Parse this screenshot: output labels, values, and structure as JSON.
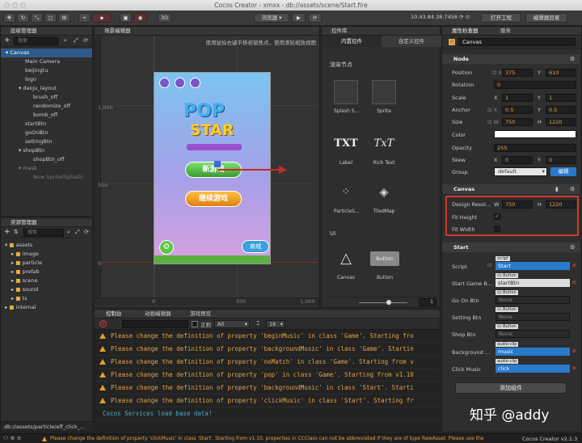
{
  "window": {
    "title": "Cocos Creator - xmxx - db://assets/scene/Start.fire"
  },
  "toolbar": {
    "btn_3d": "3D",
    "browser": "浏览器 ▾",
    "ip": "10.43.84.38:7456 ⟳ ⊙",
    "open_project": "打开工程",
    "open_editor": "编辑器目录"
  },
  "hierarchy": {
    "title": "层级管理器",
    "search": "搜索",
    "items": [
      "Canvas",
      "Main Camera",
      "beijingtu",
      "logo",
      "daoju_layout",
      "brush_off",
      "randomize_off",
      "bomb_off",
      "startBtn",
      "goOnBtn",
      "settingBtn",
      "shopBtn",
      "shopBtn_off",
      "mask",
      "New Sprite(Splash)"
    ]
  },
  "assets": {
    "title": "资源管理器",
    "search": "搜索",
    "items": [
      "assets",
      "image",
      "particle",
      "prefab",
      "scene",
      "sound",
      "ts",
      "internal"
    ],
    "path": "db://assets/particle/eff_click_..."
  },
  "scene": {
    "tab": "场景编辑器",
    "hint": "使用鼠标右键平移视窗焦点，使用滚轮缩放视图",
    "y_labels": [
      "1,000",
      "500",
      "0"
    ],
    "x_labels": [
      "0",
      "500",
      "1,000"
    ],
    "start_btn": "新游戏",
    "continue_btn": "继续游戏",
    "shop": "商城",
    "pop": "POP",
    "star": "STAR"
  },
  "bottom_tabs": [
    "控制台",
    "动画编辑器",
    "游戏预览"
  ],
  "console": {
    "level": "All",
    "font_size": "16",
    "regex": "正则",
    "logs": [
      "Please change the definition of property 'beginMusic' in class 'Game'. Starting fro",
      "Please change the definition of property 'backgroundMusic' in class 'Game'. Startin",
      "Please change the definition of property 'noMatch' in class 'Game'. Starting from v",
      "Please change the definition of property 'pop' in class 'Game'. Starting from v1.10",
      "Please change the definition of property 'backgroundMusic' in class 'Start'. Starti",
      "Please change the definition of property 'clickMusic' in class 'Start'. Starting fr"
    ],
    "service": "Cocos Services load base data!"
  },
  "library": {
    "title": "控件库",
    "tab_builtin": "内置控件",
    "tab_custom": "自定义控件",
    "render_title": "渲染节点",
    "ui_title": "UI",
    "items": [
      "Splash S...",
      "Sprite",
      "Label",
      "Rich Text",
      "ParticleS...",
      "TiledMap",
      "Canvas",
      "Button"
    ],
    "zoom_value": "1"
  },
  "inspector": {
    "title": "属性检查器",
    "tab_service": "服务",
    "node_name": "Canvas",
    "node": {
      "title": "Node",
      "position_x": "375",
      "position_y": "610",
      "rotation": "0",
      "scale_x": "1",
      "scale_y": "1",
      "anchor_x": "0.5",
      "anchor_y": "0.5",
      "size_w": "750",
      "size_h": "1220",
      "color": "",
      "opacity": "255",
      "skew_x": "0",
      "skew_y": "0",
      "group": "default",
      "edit": "编辑",
      "labels": [
        "Position",
        "Rotation",
        "Scale",
        "Anchor",
        "Size",
        "Color",
        "Opacity",
        "Skew",
        "Group"
      ]
    },
    "canvas": {
      "title": "Canvas",
      "design_label": "Design Resol...",
      "design_w": "750",
      "design_h": "1220",
      "fit_height": "Fit Height",
      "fit_width": "Fit Width"
    },
    "start": {
      "title": "Start",
      "rows": [
        {
          "label": "Script",
          "tag": "script",
          "value": "Start"
        },
        {
          "label": "Start Game B...",
          "tag": "cc.Button",
          "value": "startBtn"
        },
        {
          "label": "Go On Btn",
          "tag": "cc.Button",
          "value": "None"
        },
        {
          "label": "Setting Btn",
          "tag": "cc.Button",
          "value": "None"
        },
        {
          "label": "Shop Btn",
          "tag": "cc.Button",
          "value": "None"
        },
        {
          "label": "Background ...",
          "tag": "audio-clip",
          "value": "music"
        },
        {
          "label": "Click Music",
          "tag": "audio-clip",
          "value": "click"
        }
      ],
      "add_component": "添加组件"
    }
  },
  "status": {
    "warning": "Please change the definition of property 'clickMusic' in class 'Start'. Starting from v1.10, properties in CCClass can not be abbreviated if they are of type RawAsset. Please use the",
    "version": "Cocos Creator v2.1.3"
  },
  "watermark": "知乎 @addy"
}
